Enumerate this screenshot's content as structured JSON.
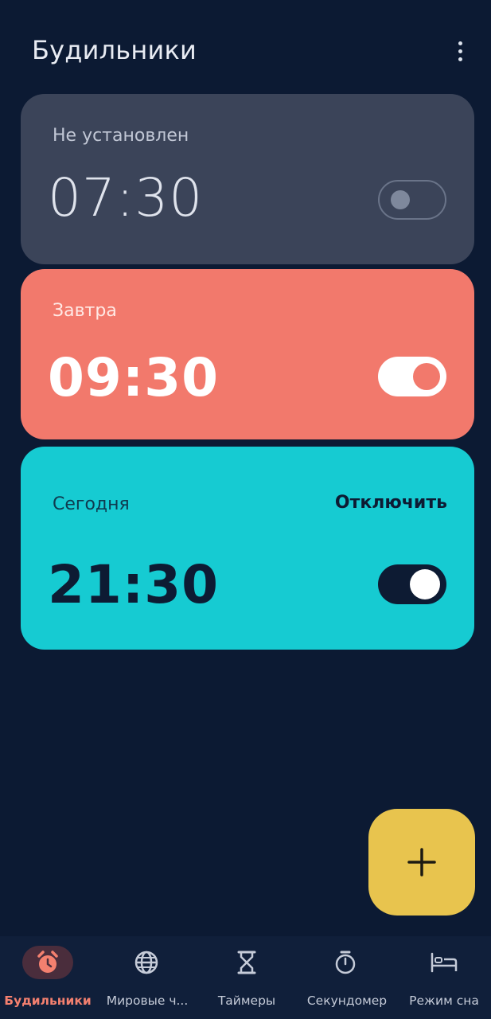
{
  "header": {
    "title": "Будильники",
    "more_icon": "more-vert-icon"
  },
  "alarms": [
    {
      "label": "Не установлен",
      "time": "07:30",
      "enabled": false,
      "color": "#3b4459"
    },
    {
      "label": "Завтра",
      "time": "09:30",
      "enabled": true,
      "color": "#f2796c"
    },
    {
      "label": "Сегодня",
      "time": "21:30",
      "enabled": true,
      "color": "#16cbd2",
      "dismiss_label": "Отключить"
    }
  ],
  "fab": {
    "icon": "plus-icon",
    "color": "#e8c44e"
  },
  "bottom_nav": {
    "items": [
      {
        "label": "Будильники",
        "icon": "alarm-clock-icon",
        "active": true
      },
      {
        "label": "Мировые ч...",
        "icon": "globe-icon",
        "active": false
      },
      {
        "label": "Таймеры",
        "icon": "hourglass-icon",
        "active": false
      },
      {
        "label": "Секундомер",
        "icon": "stopwatch-icon",
        "active": false
      },
      {
        "label": "Режим сна",
        "icon": "bed-icon",
        "active": false
      }
    ]
  },
  "colors": {
    "background": "#0c1a33",
    "accent": "#f4806f"
  }
}
